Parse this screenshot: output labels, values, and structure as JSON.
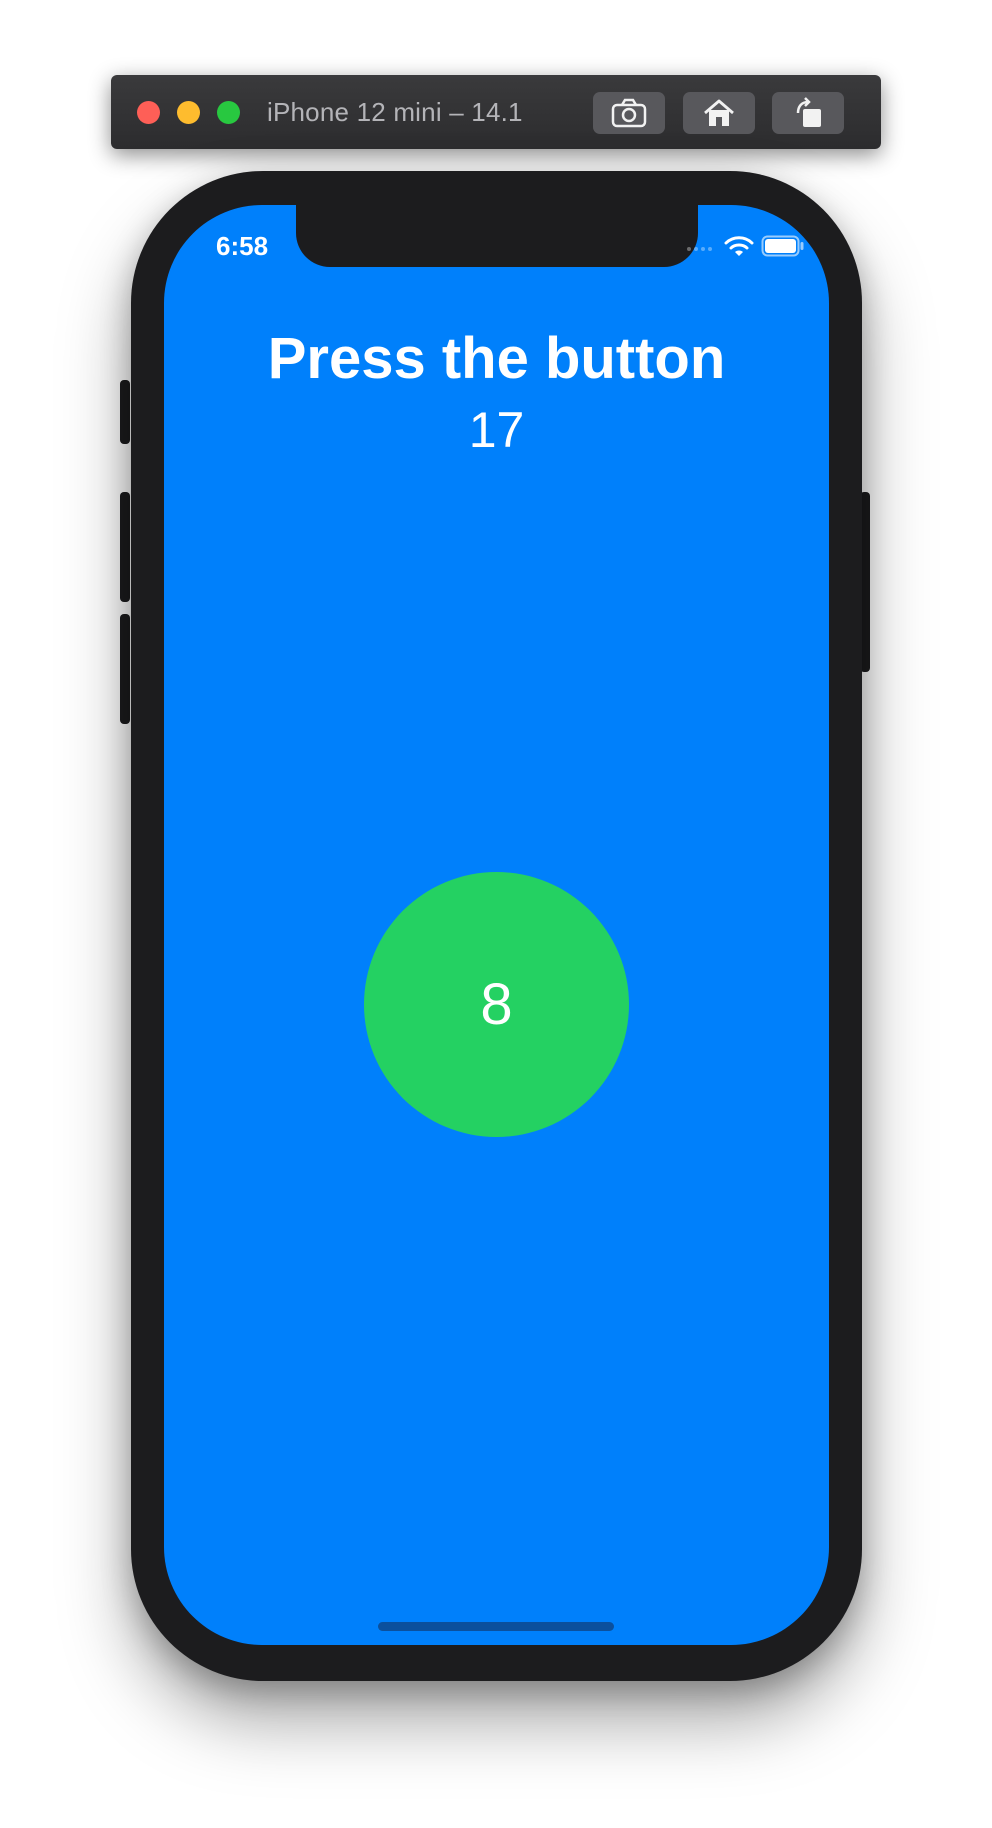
{
  "simulator": {
    "title": "iPhone 12 mini – 14.1",
    "toolbar_buttons": [
      {
        "name": "screenshot",
        "icon": "camera-icon"
      },
      {
        "name": "home",
        "icon": "home-icon"
      },
      {
        "name": "rotate",
        "icon": "rotate-icon"
      }
    ]
  },
  "status_bar": {
    "time": "6:58"
  },
  "app": {
    "title": "Press the button",
    "count": "17",
    "button_label": "8"
  },
  "colors": {
    "screen_background": "#0080fb",
    "button_color": "#24d162",
    "text": "#ffffff"
  }
}
